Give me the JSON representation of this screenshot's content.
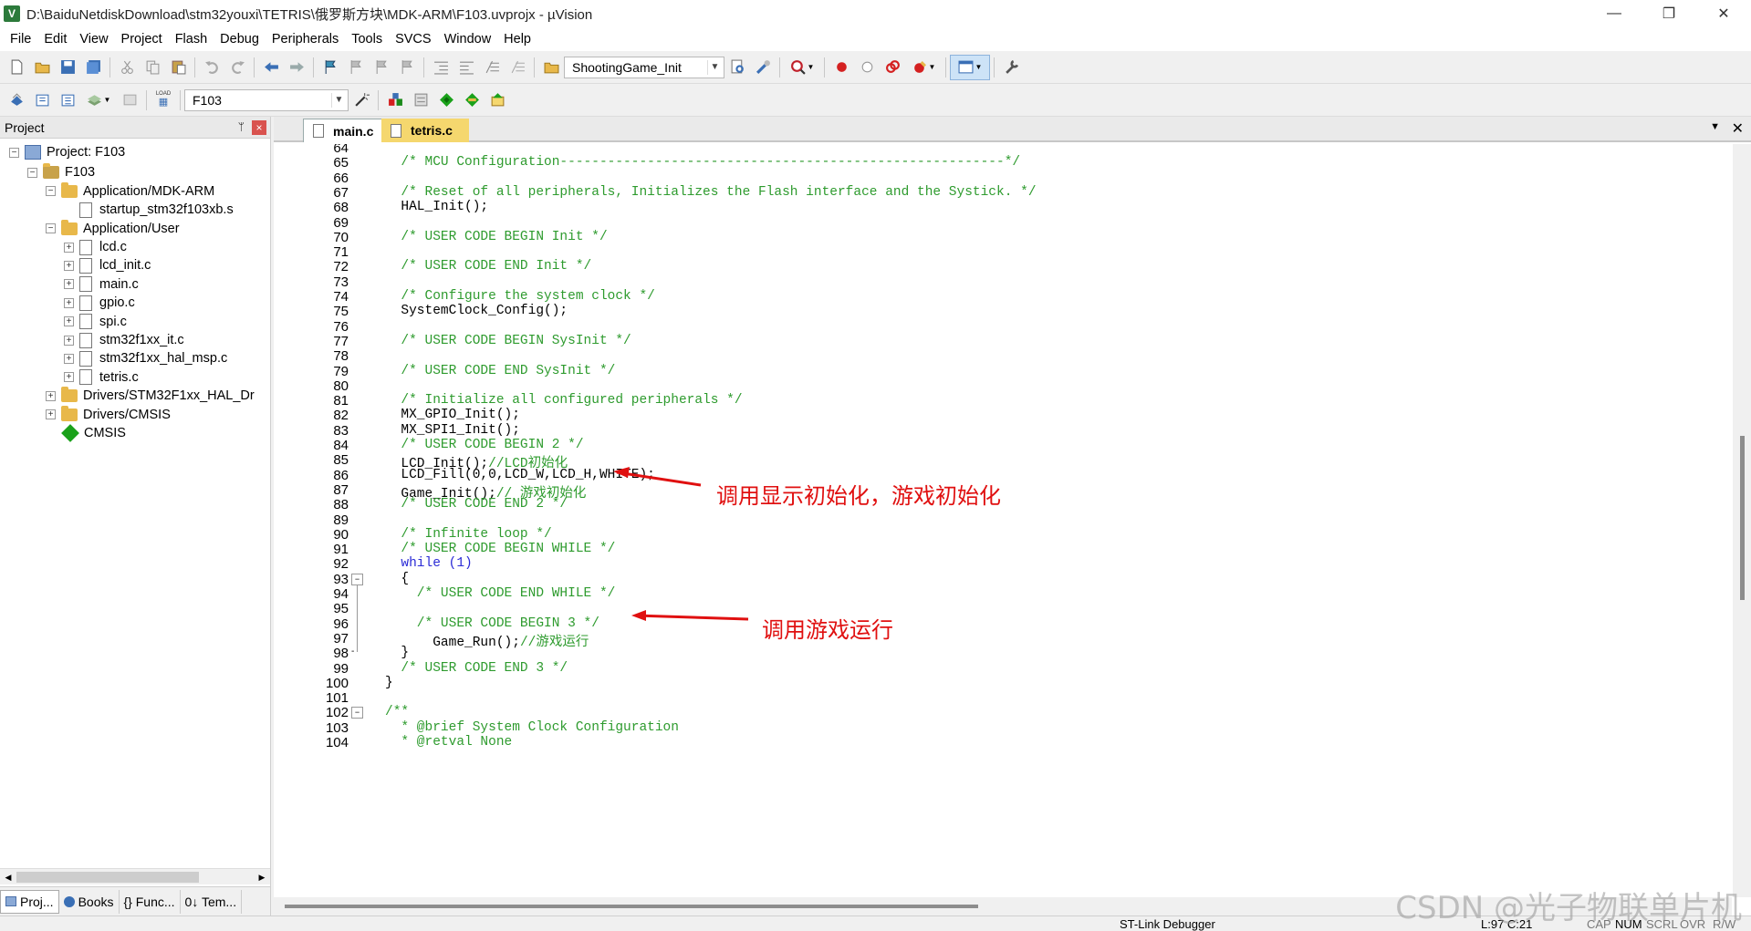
{
  "window": {
    "title": "D:\\BaiduNetdiskDownload\\stm32youxi\\TETRIS\\俄罗斯方块\\MDK-ARM\\F103.uvprojx - µVision",
    "app_icon_label": "V"
  },
  "menu": [
    "File",
    "Edit",
    "View",
    "Project",
    "Flash",
    "Debug",
    "Peripherals",
    "Tools",
    "SVCS",
    "Window",
    "Help"
  ],
  "toolbar": {
    "function_combo": "ShootingGame_Init",
    "target_combo": "F103",
    "load_label": "LOAD"
  },
  "project_panel": {
    "title": "Project",
    "pin": "ᛘ",
    "close": "×",
    "tree": [
      {
        "label": "Project: F103",
        "level": 0,
        "icon": "project-icon",
        "expander": "−"
      },
      {
        "label": "F103",
        "level": 1,
        "icon": "target-icon",
        "expander": "−"
      },
      {
        "label": "Application/MDK-ARM",
        "level": 2,
        "icon": "folder-icon",
        "expander": "−"
      },
      {
        "label": "startup_stm32f103xb.s",
        "level": 3,
        "icon": "file-icon",
        "expander": ""
      },
      {
        "label": "Application/User",
        "level": 2,
        "icon": "folder-icon",
        "expander": "−"
      },
      {
        "label": "lcd.c",
        "level": 3,
        "icon": "file-icon",
        "expander": "+"
      },
      {
        "label": "lcd_init.c",
        "level": 3,
        "icon": "file-icon",
        "expander": "+"
      },
      {
        "label": "main.c",
        "level": 3,
        "icon": "file-icon",
        "expander": "+"
      },
      {
        "label": "gpio.c",
        "level": 3,
        "icon": "file-icon",
        "expander": "+"
      },
      {
        "label": "spi.c",
        "level": 3,
        "icon": "file-icon",
        "expander": "+"
      },
      {
        "label": "stm32f1xx_it.c",
        "level": 3,
        "icon": "file-icon",
        "expander": "+"
      },
      {
        "label": "stm32f1xx_hal_msp.c",
        "level": 3,
        "icon": "file-icon",
        "expander": "+"
      },
      {
        "label": "tetris.c",
        "level": 3,
        "icon": "file-icon",
        "expander": "+"
      },
      {
        "label": "Drivers/STM32F1xx_HAL_Dr",
        "level": 2,
        "icon": "folder-icon",
        "expander": "+"
      },
      {
        "label": "Drivers/CMSIS",
        "level": 2,
        "icon": "folder-icon",
        "expander": "+"
      },
      {
        "label": "CMSIS",
        "level": 2,
        "icon": "gem-icon",
        "expander": ""
      }
    ],
    "bottom_tabs": [
      "Proj...",
      "Books",
      "{} Func...",
      "0↓ Tem..."
    ]
  },
  "editor": {
    "tabs": [
      "main.c",
      "tetris.c"
    ],
    "active_tab": "main.c",
    "lines": [
      {
        "n": "64",
        "t": ""
      },
      {
        "n": "65",
        "t": "  /* MCU Configuration--------------------------------------------------------*/",
        "c": "cm"
      },
      {
        "n": "66",
        "t": ""
      },
      {
        "n": "67",
        "t": "  /* Reset of all peripherals, Initializes the Flash interface and the Systick. */",
        "c": "cm"
      },
      {
        "n": "68",
        "t": "  HAL_Init();"
      },
      {
        "n": "69",
        "t": ""
      },
      {
        "n": "70",
        "t": "  /* USER CODE BEGIN Init */",
        "c": "cm"
      },
      {
        "n": "71",
        "t": ""
      },
      {
        "n": "72",
        "t": "  /* USER CODE END Init */",
        "c": "cm"
      },
      {
        "n": "73",
        "t": ""
      },
      {
        "n": "74",
        "t": "  /* Configure the system clock */",
        "c": "cm"
      },
      {
        "n": "75",
        "t": "  SystemClock_Config();"
      },
      {
        "n": "76",
        "t": ""
      },
      {
        "n": "77",
        "t": "  /* USER CODE BEGIN SysInit */",
        "c": "cm"
      },
      {
        "n": "78",
        "t": ""
      },
      {
        "n": "79",
        "t": "  /* USER CODE END SysInit */",
        "c": "cm"
      },
      {
        "n": "80",
        "t": ""
      },
      {
        "n": "81",
        "t": "  /* Initialize all configured peripherals */",
        "c": "cm"
      },
      {
        "n": "82",
        "t": "  MX_GPIO_Init();"
      },
      {
        "n": "83",
        "t": "  MX_SPI1_Init();"
      },
      {
        "n": "84",
        "t": "  /* USER CODE BEGIN 2 */",
        "c": "cm"
      },
      {
        "n": "85",
        "t": "  LCD_Init();",
        "tc": "//LCD初始化"
      },
      {
        "n": "86",
        "t": "  LCD_Fill(0,0,LCD_W,LCD_H,WHITE);"
      },
      {
        "n": "87",
        "t": "  Game_Init();",
        "tc": "// 游戏初始化"
      },
      {
        "n": "88",
        "t": "  /* USER CODE END 2 */",
        "c": "cm"
      },
      {
        "n": "89",
        "t": ""
      },
      {
        "n": "90",
        "t": "  /* Infinite loop */",
        "c": "cm"
      },
      {
        "n": "91",
        "t": "  /* USER CODE BEGIN WHILE */",
        "c": "cm"
      },
      {
        "n": "92",
        "t": "  while (1)",
        "kw": true
      },
      {
        "n": "93",
        "t": "  {"
      },
      {
        "n": "94",
        "t": "    /* USER CODE END WHILE */",
        "c": "cm"
      },
      {
        "n": "95",
        "t": ""
      },
      {
        "n": "96",
        "t": "    /* USER CODE BEGIN 3 */",
        "c": "cm"
      },
      {
        "n": "97",
        "t": "      Game_Run();",
        "tc": "//游戏运行"
      },
      {
        "n": "98",
        "t": "  }"
      },
      {
        "n": "99",
        "t": "  /* USER CODE END 3 */",
        "c": "cm"
      },
      {
        "n": "100",
        "t": "}"
      },
      {
        "n": "101",
        "t": ""
      },
      {
        "n": "102",
        "t": "/**",
        "c": "cm"
      },
      {
        "n": "103",
        "t": "  * @brief System Clock Configuration",
        "c": "cm"
      },
      {
        "n": "104",
        "t": "  * @retval None",
        "c": "cm"
      }
    ],
    "annotations": [
      "调用显示初始化，游戏初始化",
      "调用游戏运行"
    ]
  },
  "status": {
    "debugger": "ST-Link Debugger",
    "cursor": "L:97 C:21",
    "flags": [
      "CAP",
      "NUM",
      "SCRL",
      "OVR",
      "R/W"
    ]
  },
  "watermark": "CSDN @光子物联单片机",
  "colors": {
    "comment": "#2e9b2e",
    "keyword": "#2b2bd6",
    "annotation": "#e01010",
    "tab_active_bg": "#ffffff",
    "tab_inactive_bg": "#f5d76e"
  }
}
